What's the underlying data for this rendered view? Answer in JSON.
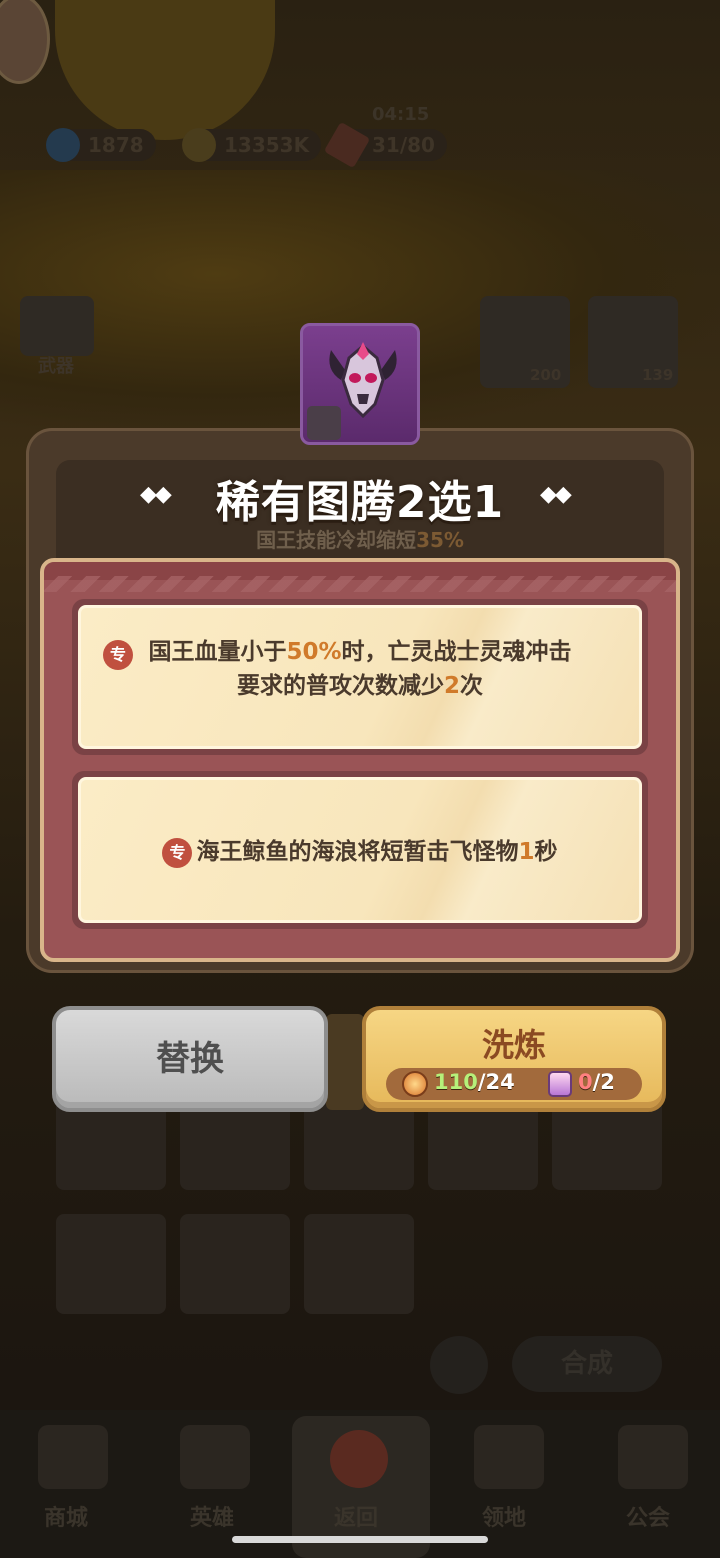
{
  "hud": {
    "timer": "04:15",
    "gems": "1878",
    "gold": "13353K",
    "energy": "31/80"
  },
  "background": {
    "weapon_label": "武器",
    "merge_label": "合成",
    "item_values": [
      "200",
      "139"
    ]
  },
  "bottom_nav": {
    "shop": "商城",
    "heroes": "英雄",
    "back": "返回",
    "territory": "领地",
    "guild": "公会"
  },
  "popup": {
    "title": "稀有图腾2选1",
    "subtitle_prefix": "国王技能冷却缩短",
    "subtitle_value": "35%",
    "options": [
      {
        "badge": "专",
        "line1_a": "国王血量小于",
        "line1_hl": "50%",
        "line1_b": "时，亡灵战士灵魂冲击",
        "line2_a": "要求的普攻次数减少",
        "line2_hl": "2",
        "line2_b": "次"
      },
      {
        "badge": "专",
        "line1_a": "海王鲸鱼的海浪将短暂击飞怪物",
        "line1_hl": "1",
        "line1_b": "秒"
      }
    ],
    "replace_button": "替换",
    "refine_button": "洗炼",
    "cost_stones_have": "110",
    "cost_stones_need": "/24",
    "cost_crystal_have": "0",
    "cost_crystal_need": "/2"
  },
  "colors": {
    "highlight": "#d07a2a",
    "card_bg": "#fbecc6",
    "board": "#9a5456"
  }
}
